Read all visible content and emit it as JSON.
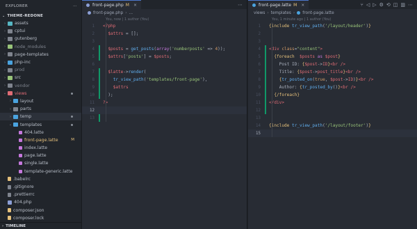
{
  "sidebar": {
    "title": "EXPLORER",
    "more_icon": "ellipsis-icon",
    "section": "THEME-REDONE",
    "timeline": "TIMELINE",
    "items": [
      {
        "label": "assets",
        "kind": "folder",
        "color": "folder-teal",
        "chev": "›",
        "indent": 0
      },
      {
        "label": "cptui",
        "kind": "folder",
        "color": "folder-gray",
        "chev": "›",
        "indent": 0
      },
      {
        "label": "gutenberg",
        "kind": "folder",
        "color": "folder-gray",
        "chev": "›",
        "indent": 0
      },
      {
        "label": "node_modules",
        "kind": "folder",
        "color": "folder-green",
        "chev": "›",
        "indent": 0,
        "muted": true
      },
      {
        "label": "page-templates",
        "kind": "folder",
        "color": "folder-gray",
        "chev": "›",
        "indent": 0
      },
      {
        "label": "php-inc",
        "kind": "folder",
        "color": "folder-blue",
        "chev": "›",
        "indent": 0
      },
      {
        "label": "prod",
        "kind": "folder",
        "color": "folder-gray",
        "chev": "›",
        "indent": 0,
        "muted": true
      },
      {
        "label": "src",
        "kind": "folder",
        "color": "folder-green",
        "chev": "›",
        "indent": 0
      },
      {
        "label": "vendor",
        "kind": "folder",
        "color": "folder-gray",
        "chev": "›",
        "indent": 0,
        "muted": true
      },
      {
        "label": "views",
        "kind": "folder",
        "color": "folder-red",
        "chev": "⌄",
        "indent": 0,
        "dot": true,
        "red": true
      },
      {
        "label": "layout",
        "kind": "folder",
        "color": "folder-blue",
        "chev": "›",
        "indent": 1
      },
      {
        "label": "parts",
        "kind": "folder",
        "color": "folder-gray",
        "chev": "›",
        "indent": 1
      },
      {
        "label": "temp",
        "kind": "folder",
        "color": "folder-blue",
        "chev": "›",
        "indent": 1,
        "dot": true,
        "active": true
      },
      {
        "label": "templates",
        "kind": "folder",
        "color": "folder-blue",
        "chev": "⌄",
        "indent": 1,
        "dot": true
      },
      {
        "label": "404.latte",
        "kind": "file",
        "color": "file-latte",
        "chev": "",
        "indent": 2
      },
      {
        "label": "front-page.latte",
        "kind": "file",
        "color": "file-latte",
        "chev": "",
        "indent": 2,
        "badge": "M"
      },
      {
        "label": "index.latte",
        "kind": "file",
        "color": "file-latte",
        "chev": "",
        "indent": 2
      },
      {
        "label": "page.latte",
        "kind": "file",
        "color": "file-latte",
        "chev": "",
        "indent": 2
      },
      {
        "label": "single.latte",
        "kind": "file",
        "color": "file-latte",
        "chev": "",
        "indent": 2
      },
      {
        "label": "template-generic.latte",
        "kind": "file",
        "color": "file-latte",
        "chev": "",
        "indent": 2
      },
      {
        "label": ".babelrc",
        "kind": "file",
        "color": "file-json",
        "chev": "",
        "indent": 0
      },
      {
        "label": ".gitignore",
        "kind": "file",
        "color": "file-dot",
        "chev": "",
        "indent": 0
      },
      {
        "label": ".prettierrc",
        "kind": "file",
        "color": "file-dot",
        "chev": "",
        "indent": 0
      },
      {
        "label": "404.php",
        "kind": "file",
        "color": "file-php",
        "chev": "",
        "indent": 0
      },
      {
        "label": "composer.json",
        "kind": "file",
        "color": "file-json",
        "chev": "",
        "indent": 0
      },
      {
        "label": "composer.lock",
        "kind": "file",
        "color": "file-json",
        "chev": "",
        "indent": 0
      }
    ]
  },
  "editor1": {
    "tab_label": "front-page.php",
    "tab_modified": "M",
    "tab_close": "×",
    "tab_icon": "php-file-icon",
    "actions": "⋯",
    "breadcrumb": [
      "front-page.php",
      "..."
    ],
    "blame": "You, now | 1 author (You)",
    "lines": [
      {
        "n": "1",
        "html": "<span class='v'>&lt;?php</span>"
      },
      {
        "n": "2",
        "html": "  <span class='v'>$attrs</span> <span class='p'>=</span> <span class='p'>[];</span>"
      },
      {
        "n": "3",
        "html": ""
      },
      {
        "n": "4",
        "html": "  <span class='v'>$posts</span> <span class='p'>=</span> <span class='f'>get_posts</span><span class='p'>(</span><span class='k'>array</span><span class='p'>(</span><span class='s'>'numberposts'</span> <span class='p'>=&gt;</span> <span class='n'>4</span><span class='p'>));</span>",
        "added": true
      },
      {
        "n": "5",
        "html": "  <span class='v'>$attrs</span><span class='p'>[</span><span class='s'>'posts'</span><span class='p'>]</span> <span class='p'>=</span> <span class='v'>$posts</span><span class='p'>;</span>",
        "added": true
      },
      {
        "n": "6",
        "html": ""
      },
      {
        "n": "7",
        "html": "  <span class='v'>$latte</span><span class='p'>-&gt;</span><span class='f'>render</span><span class='p'>(</span>",
        "added": true
      },
      {
        "n": "8",
        "html": "    <span class='f'>tr_view_path</span><span class='p'>(</span><span class='s'>'templates/front-page'</span><span class='p'>),</span>",
        "added": true
      },
      {
        "n": "9",
        "html": "    <span class='v'>$attrs</span>",
        "added": true
      },
      {
        "n": "10",
        "html": "  <span class='p'>);</span>",
        "added": true
      },
      {
        "n": "11",
        "html": "<span class='v'>?&gt;</span>"
      },
      {
        "n": "12",
        "html": "",
        "current": true
      },
      {
        "n": "13",
        "html": "",
        "added": true
      }
    ]
  },
  "editor2": {
    "tab_label": "front-page.latte",
    "tab_modified": "M",
    "tab_close": "×",
    "tab_icon": "latte-file-icon",
    "actions": [
      "source-control-icon",
      "go-back-icon",
      "go-forward-icon",
      "settings-icon",
      "sync-icon",
      "split-icon",
      "layout-icon",
      "more-icon"
    ],
    "breadcrumb": [
      "views",
      "templates",
      "front-page.latte"
    ],
    "blame": "You, 1 minute ago | 1 author (You)",
    "lines": [
      {
        "n": "1",
        "html": "<span class='y'>{include</span> <span class='f'>tr_view_path</span><span class='p'>(</span><span class='s'>'/layout/header'</span><span class='p'>)</span><span class='y'>}</span>"
      },
      {
        "n": "2",
        "html": ""
      },
      {
        "n": "3",
        "html": ""
      },
      {
        "n": "4",
        "html": "<span class='t'>&lt;div</span> <span class='n'>class</span><span class='p'>=</span><span class='s'>\"content\"</span><span class='t'>&gt;</span>",
        "added": true
      },
      {
        "n": "5",
        "html": "  <span class='y'>{foreach</span>  <span class='v'>$posts</span> <span class='k'>as</span> <span class='v'>$post</span><span class='y'>}</span>",
        "added": true
      },
      {
        "n": "6",
        "html": "    <span class='p'>Post ID:</span> <span class='y'>{</span><span class='v'>$post</span><span class='p'>-&gt;</span><span class='v'>ID</span><span class='y'>}</span><span class='t'>&lt;br /&gt;</span>",
        "added": true
      },
      {
        "n": "7",
        "html": "    <span class='p'>Title:</span> <span class='y'>{</span><span class='v'>$post</span><span class='p'>-&gt;</span><span class='v'>post_title</span><span class='y'>}</span><span class='t'>&lt;br /&gt;</span>",
        "added": true
      },
      {
        "n": "8",
        "html": "    <span class='y'>{</span><span class='f'>tr_posted_on</span><span class='p'>(</span><span class='n'>true</span><span class='p'>,</span> <span class='v'>$post</span><span class='p'>-&gt;</span><span class='v'>ID</span><span class='p'>)</span><span class='y'>}</span><span class='t'>&lt;br /&gt;</span>",
        "added": true
      },
      {
        "n": "9",
        "html": "    <span class='p'>Author:</span> <span class='y'>{</span><span class='f'>tr_posted_by</span><span class='p'>()</span><span class='y'>}</span><span class='t'>&lt;br /&gt;</span>",
        "added": true
      },
      {
        "n": "10",
        "html": "  <span class='y'>{/foreach}</span>",
        "added": true
      },
      {
        "n": "11",
        "html": "<span class='t'>&lt;/div&gt;</span>",
        "added": true
      },
      {
        "n": "12",
        "html": "",
        "added": true
      },
      {
        "n": "13",
        "html": ""
      },
      {
        "n": "14",
        "html": "<span class='y'>{include</span> <span class='f'>tr_view_path</span><span class='p'>(</span><span class='s'>'/layout/footer'</span><span class='p'>)</span><span class='y'>}</span>"
      },
      {
        "n": "15",
        "html": "",
        "current": true
      }
    ]
  },
  "colors": {
    "accent": "#4d78cc",
    "added": "#109868",
    "modified": "#e5c07b"
  }
}
